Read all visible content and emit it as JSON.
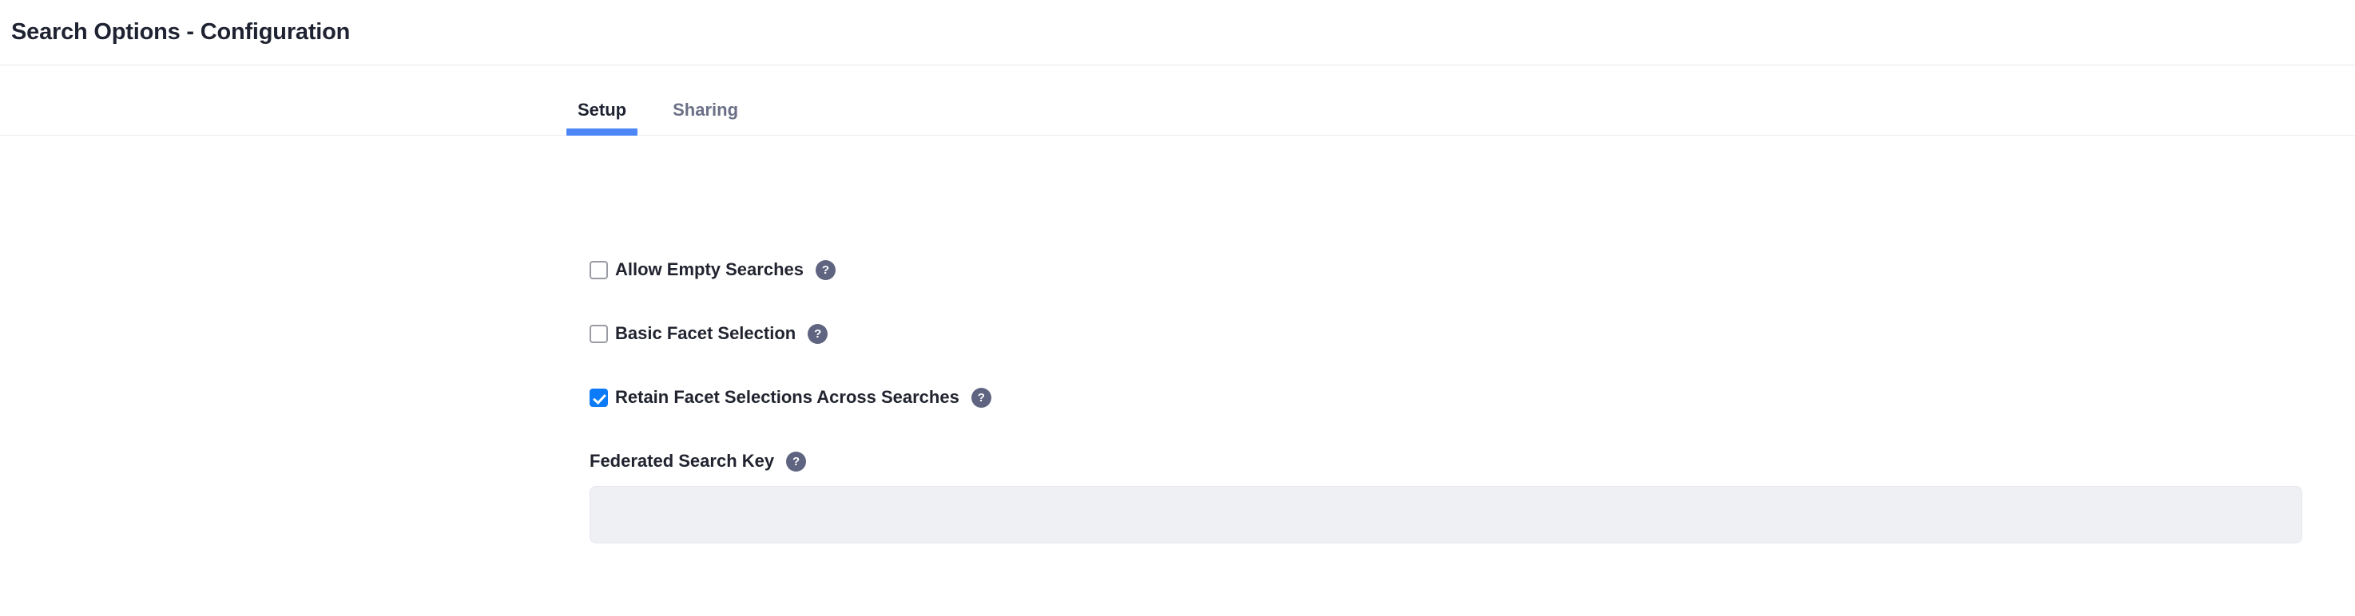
{
  "header": {
    "title": "Search Options - Configuration"
  },
  "tabs": [
    {
      "label": "Setup",
      "active": true
    },
    {
      "label": "Sharing",
      "active": false
    }
  ],
  "form": {
    "checkboxes": [
      {
        "label": "Allow Empty Searches",
        "checked": false,
        "help_icon": "help-question-icon",
        "help_glyph": "?"
      },
      {
        "label": "Basic Facet Selection",
        "checked": false,
        "help_icon": "help-question-icon",
        "help_glyph": "?"
      },
      {
        "label": "Retain Facet Selections Across Searches",
        "checked": true,
        "help_icon": "help-question-icon",
        "help_glyph": "?"
      }
    ],
    "federated_search_key": {
      "label": "Federated Search Key",
      "help_glyph": "?",
      "value": "",
      "placeholder": ""
    }
  },
  "colors": {
    "accent_blue": "#4d86f7",
    "checkbox_blue": "#0b7bf7",
    "help_bubble": "#5f6480",
    "input_background": "#eff0f4",
    "title_text": "#1f2331",
    "inactive_tab_text": "#6b7087",
    "border": "#e7e8ee"
  }
}
